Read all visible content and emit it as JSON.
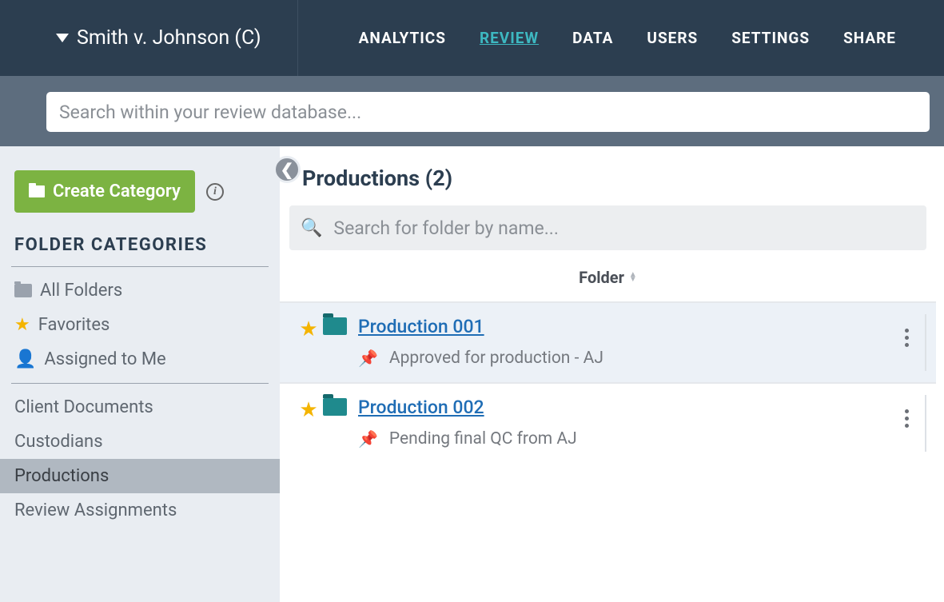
{
  "header": {
    "project_name": "Smith v. Johnson (C)",
    "nav": [
      {
        "label": "ANALYTICS",
        "active": false
      },
      {
        "label": "REVIEW",
        "active": true
      },
      {
        "label": "DATA",
        "active": false
      },
      {
        "label": "USERS",
        "active": false
      },
      {
        "label": "SETTINGS",
        "active": false
      },
      {
        "label": "SHARE",
        "active": false
      }
    ]
  },
  "global_search": {
    "placeholder": "Search within your review database..."
  },
  "sidebar": {
    "create_label": "Create Category",
    "heading": "FOLDER CATEGORIES",
    "system_items": [
      {
        "icon": "folder",
        "label": "All Folders"
      },
      {
        "icon": "star",
        "label": "Favorites"
      },
      {
        "icon": "person",
        "label": "Assigned to Me"
      }
    ],
    "user_items": [
      {
        "label": "Client Documents",
        "selected": false
      },
      {
        "label": "Custodians",
        "selected": false
      },
      {
        "label": "Productions",
        "selected": true
      },
      {
        "label": "Review Assignments",
        "selected": false
      }
    ]
  },
  "content": {
    "title": "Productions (2)",
    "folder_search_placeholder": "Search for folder by name...",
    "column_label": "Folder",
    "rows": [
      {
        "title": "Production 001",
        "note": "Approved for production - AJ",
        "highlighted": true
      },
      {
        "title": "Production 002",
        "note": "Pending final QC from AJ",
        "highlighted": false
      }
    ]
  }
}
